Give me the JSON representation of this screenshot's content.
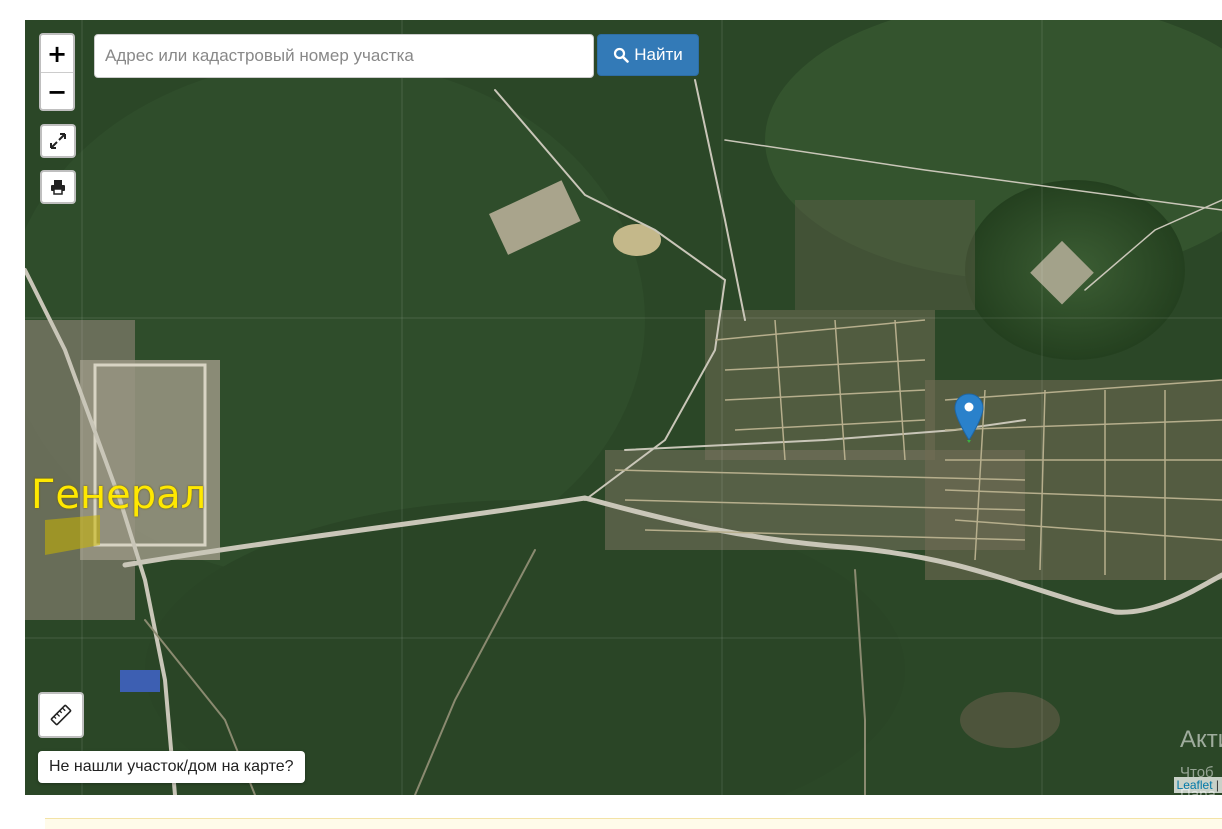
{
  "search": {
    "placeholder": "Адрес или кадастровый номер участка",
    "button_label": "Найти"
  },
  "zoom": {
    "in_label": "+",
    "out_label": "−"
  },
  "map": {
    "place_label": "Генерал",
    "marker_color": "#2a81cb",
    "label_color": "#ffe800"
  },
  "notfound_label": "Не нашли участок/дом на карте?",
  "attribution": {
    "link": "Leaflet",
    "separator": " |"
  },
  "activation": {
    "title": "Акти",
    "line1": "Чтоб",
    "line2": "Пара"
  },
  "icons": [
    "fullscreen-icon",
    "print-icon",
    "ruler-icon",
    "search-icon",
    "map-marker-icon"
  ]
}
